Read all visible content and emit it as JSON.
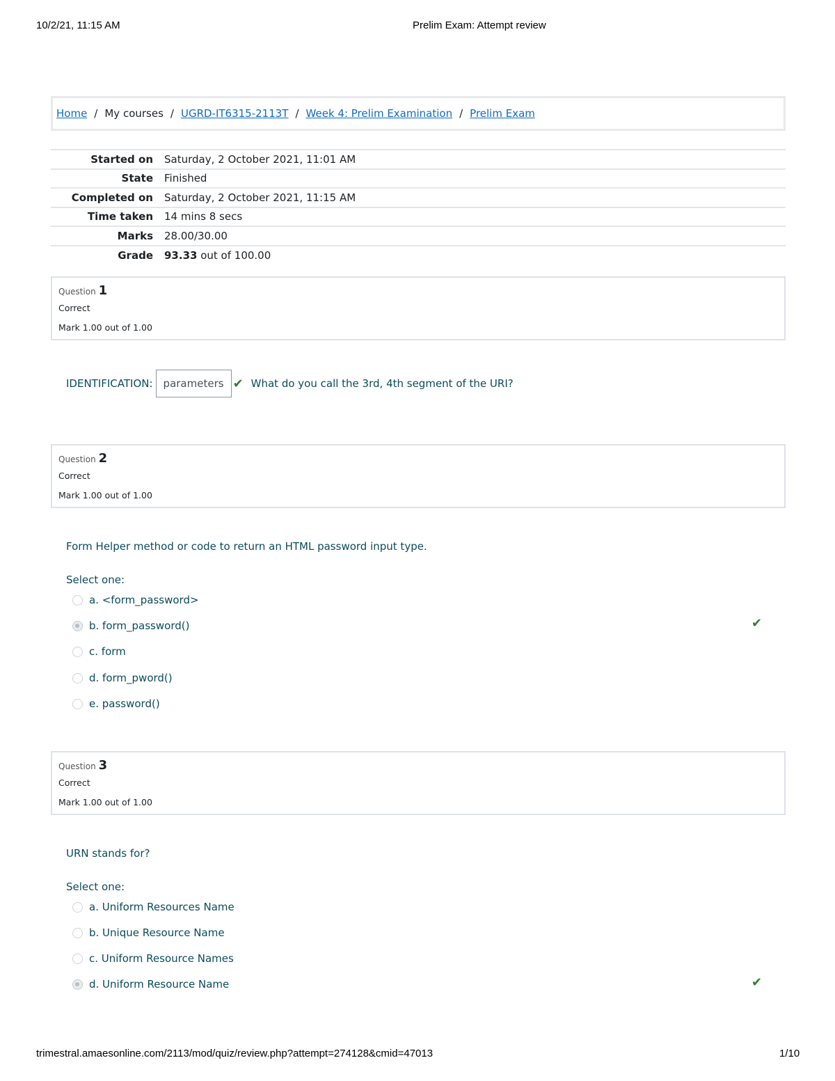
{
  "print_header": {
    "date": "10/2/21, 11:15 AM",
    "title": "Prelim Exam: Attempt review"
  },
  "print_footer": {
    "url": "trimestral.amaesonline.com/2113/mod/quiz/review.php?attempt=274128&cmid=47013",
    "page": "1/10"
  },
  "breadcrumb": [
    {
      "label": "Home",
      "link": true
    },
    {
      "label": "My courses",
      "link": false
    },
    {
      "label": "UGRD-IT6315-2113T",
      "link": true
    },
    {
      "label": "Week 4: Prelim Examination",
      "link": true
    },
    {
      "label": "Prelim Exam",
      "link": true
    }
  ],
  "summary": {
    "started_on": {
      "label": "Started on",
      "value": "Saturday, 2 October 2021, 11:01 AM"
    },
    "state": {
      "label": "State",
      "value": "Finished"
    },
    "completed_on": {
      "label": "Completed on",
      "value": "Saturday, 2 October 2021, 11:15 AM"
    },
    "time_taken": {
      "label": "Time taken",
      "value": "14 mins 8 secs"
    },
    "marks": {
      "label": "Marks",
      "value": "28.00/30.00"
    },
    "grade": {
      "label": "Grade",
      "value_bold": "93.33",
      "value_rest": " out of 100.00"
    }
  },
  "questions": [
    {
      "label": "Question",
      "number": "1",
      "state": "Correct",
      "mark": "Mark 1.00 out of 1.00",
      "prefix": "IDENTIFICATION:",
      "answer": "parameters",
      "text": "What do you call the 3rd, 4th segment of the URI?"
    },
    {
      "label": "Question",
      "number": "2",
      "state": "Correct",
      "mark": "Mark 1.00 out of 1.00",
      "text": "Form Helper method or code to return an HTML password input type.",
      "select_label": "Select one:",
      "options": [
        {
          "label": "a. <form_password>",
          "selected": false
        },
        {
          "label": "b. form_password()",
          "selected": true,
          "correct": true
        },
        {
          "label": "c. form",
          "selected": false
        },
        {
          "label": "d. form_pword()",
          "selected": false
        },
        {
          "label": "e. password()",
          "selected": false
        }
      ]
    },
    {
      "label": "Question",
      "number": "3",
      "state": "Correct",
      "mark": "Mark 1.00 out of 1.00",
      "text": "URN stands for?",
      "select_label": "Select one:",
      "options": [
        {
          "label": "a. Uniform Resources Name",
          "selected": false
        },
        {
          "label": "b. Unique Resource Name",
          "selected": false
        },
        {
          "label": "c. Uniform Resource Names",
          "selected": false
        },
        {
          "label": "d. Uniform Resource Name",
          "selected": true,
          "correct": true
        }
      ]
    }
  ],
  "icons": {
    "correct": "check-icon"
  },
  "colors": {
    "link": "#0f6cbf",
    "question_text": "#0b4b5c",
    "correct": "#357a32"
  }
}
